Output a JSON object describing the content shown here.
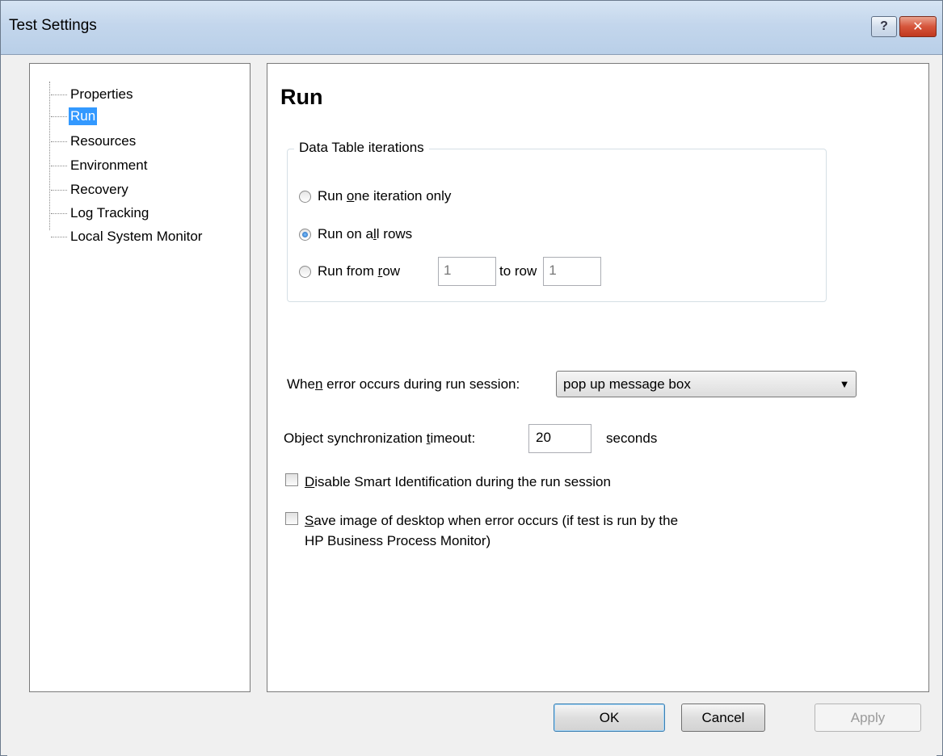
{
  "window": {
    "title": "Test Settings",
    "help_glyph": "?",
    "close_glyph": "✕"
  },
  "tree": {
    "items": [
      {
        "label": "Properties",
        "selected": false
      },
      {
        "label": "Run",
        "selected": true
      },
      {
        "label": "Resources",
        "selected": false
      },
      {
        "label": "Environment",
        "selected": false
      },
      {
        "label": "Recovery",
        "selected": false
      },
      {
        "label": "Log Tracking",
        "selected": false
      },
      {
        "label": "Local System Monitor",
        "selected": false
      }
    ]
  },
  "run": {
    "title": "Run",
    "iterations_group": {
      "title": "Data Table iterations",
      "option1_pre": "Run ",
      "option1_key": "o",
      "option1_post": "ne iteration only",
      "option2_pre": "Run on a",
      "option2_key": "l",
      "option2_post": "l rows",
      "option3_pre": "Run from ",
      "option3_key": "r",
      "option3_post": "ow",
      "from_row_value": "1",
      "to_row_label": "to row",
      "to_row_value": "1",
      "selected_option": 2
    },
    "error_label_pre": "Whe",
    "error_label_key": "n",
    "error_label_post": " error occurs during run session:",
    "error_select_value": "pop up message box",
    "timeout_label_pre": "Object synchronization ",
    "timeout_label_key": "t",
    "timeout_label_post": "imeout:",
    "timeout_value": "20",
    "timeout_unit": "seconds",
    "disable_smart_key": "D",
    "disable_smart_post": "isable Smart Identification during the run session",
    "save_image_key": "S",
    "save_image_line1": "ave image of desktop when error occurs (if test is run by the",
    "save_image_line2": "HP Business Process Monitor)"
  },
  "buttons": {
    "ok": "OK",
    "cancel": "Cancel",
    "apply": "Apply"
  }
}
